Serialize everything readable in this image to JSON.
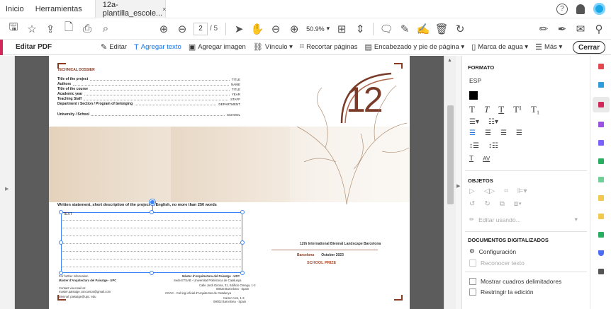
{
  "menubar": {
    "inicio": "Inicio",
    "herramientas": "Herramientas",
    "tab_title": "12a-plantilla_escole...",
    "tab_close": "×",
    "help": "?"
  },
  "toolbar": {
    "page_current": "2",
    "page_total": "/ 5",
    "zoom": "50.9%"
  },
  "editbar": {
    "title": "Editar PDF",
    "items": [
      "Editar",
      "Agregar texto",
      "Agregar imagen",
      "Vínculo ▾",
      "Recortar páginas",
      "Encabezado y pie de página ▾",
      "Marca de agua ▾",
      "Más ▾"
    ],
    "close": "Cerrar"
  },
  "doc": {
    "dossier": "TECHNICAL DOSSIER",
    "fields": [
      {
        "label": "Title of the project",
        "value": "TITLE"
      },
      {
        "label": "Authors",
        "value": "NAME"
      },
      {
        "label": "Title of the course",
        "value": "TITLE"
      },
      {
        "label": "Academic year",
        "value": "YEAR"
      },
      {
        "label": "Teaching Staff",
        "value": "STAFF"
      },
      {
        "label": "Department / Section / Program of belonging",
        "value": "DEPARTMENT"
      },
      {
        "label": "University / School",
        "value": "SCHOOL"
      }
    ],
    "big_number": "12",
    "statement": "Written statement, short description of the project in English, no more than 250 words",
    "text_placeholder": "TEXT",
    "footer_left": [
      "For further information",
      "Màster d'Arquitectura del Paisatge - UPC",
      "",
      "Contact via email at:",
      "master.paisatge.concursos@gmail.com",
      "Biennal: paisatge@upc. edu"
    ],
    "footer_mid": [
      "Màster d'Arquitectura del Paisatge - UPC",
      "Sede ETSAB - Universitat Politècnica de Catalunya",
      "Calle Jordi Girona, 31, Edificio Omega, 1-2",
      "08034 Barcelona - Spain",
      "COAC - Col·legi oficial d'Arquitectes de Catalunya",
      "Carrer Arcs, 1-3",
      "08002 Barcelona - Spain"
    ],
    "biennal": "12th International Biennal Landscape Barcelona",
    "barcelona": "Barcelona",
    "october": "October 2023",
    "prize": "SCHOOL PRIZE"
  },
  "panel": {
    "formato": "FORMATO",
    "font": "ESP",
    "objetos": "OBJETOS",
    "editar_usando": "Editar usando...",
    "docs": "DOCUMENTOS DIGITALIZADOS",
    "config": "Configuración",
    "reconocer": "Reconocer texto",
    "mostrar": "Mostrar cuadros delimitadores",
    "restringir": "Restringir la edición"
  },
  "colors": {
    "accent": "#d2275b",
    "link": "#1473e6",
    "brand": "#8a3a20"
  }
}
